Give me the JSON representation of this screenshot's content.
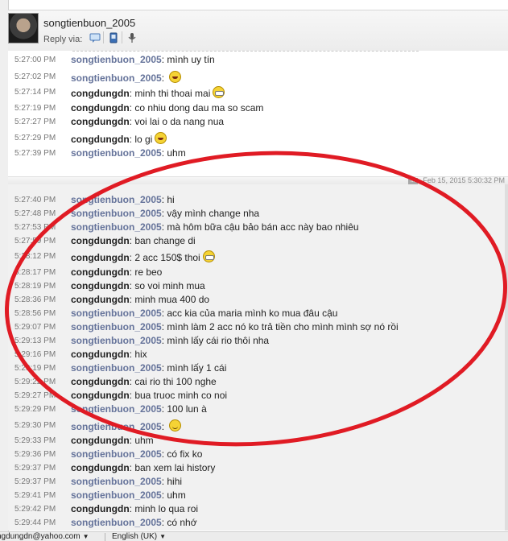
{
  "header": {
    "contact_name": "songtienbuon_2005",
    "reply_via_label": "Reply via:",
    "reply_icons": [
      "message-icon",
      "sms-icon",
      "voice-icon"
    ]
  },
  "colors": {
    "sender_other": "#65739a",
    "sender_self": "#222222",
    "annotation_ellipse": "#e01b24"
  },
  "conversation_1": {
    "messages": [
      {
        "time": "5:27:00 PM",
        "sender": "songtienbuon_2005",
        "text": "mình uy tín"
      },
      {
        "time": "5:27:02 PM",
        "sender": "songtienbuon_2005",
        "text": "",
        "emoticon": "laugh-emoticon"
      },
      {
        "time": "5:27:14 PM",
        "sender": "congdungdn",
        "text": "minh thi thoai mai",
        "emoticon": "grin-emoticon"
      },
      {
        "time": "5:27:19 PM",
        "sender": "congdungdn",
        "text": "co nhiu dong dau ma so scam"
      },
      {
        "time": "5:27:27 PM",
        "sender": "congdungdn",
        "text": "voi lai o da nang nua"
      },
      {
        "time": "5:27:29 PM",
        "sender": "congdungdn",
        "text": "lo gi",
        "emoticon": "laugh-emoticon"
      },
      {
        "time": "5:27:39 PM",
        "sender": "songtienbuon_2005",
        "text": "uhm"
      }
    ]
  },
  "divider": {
    "date": "Feb 15, 2015 5:30:32 PM"
  },
  "conversation_2": {
    "messages": [
      {
        "time": "5:27:40 PM",
        "sender": "songtienbuon_2005",
        "text": "hi"
      },
      {
        "time": "5:27:48 PM",
        "sender": "songtienbuon_2005",
        "text": "vậy mình change nha"
      },
      {
        "time": "5:27:53 PM",
        "sender": "songtienbuon_2005",
        "text": "mà hôm bữa cậu bảo bán acc này bao nhiêu"
      },
      {
        "time": "5:27:59 PM",
        "sender": "congdungdn",
        "text": "ban change di"
      },
      {
        "time": "5:28:12 PM",
        "sender": "congdungdn",
        "text": "2 acc 150$ thoi",
        "emoticon": "grin-emoticon"
      },
      {
        "time": "5:28:17 PM",
        "sender": "congdungdn",
        "text": "re beo"
      },
      {
        "time": "5:28:19 PM",
        "sender": "congdungdn",
        "text": "so voi minh mua"
      },
      {
        "time": "5:28:36 PM",
        "sender": "congdungdn",
        "text": "minh mua 400 do"
      },
      {
        "time": "5:28:56 PM",
        "sender": "songtienbuon_2005",
        "text": "acc kia của maria mình ko mua đâu cậu"
      },
      {
        "time": "5:29:07 PM",
        "sender": "songtienbuon_2005",
        "text": "mình làm 2 acc nó ko trả tiền cho mình mình sợ nó rồi"
      },
      {
        "time": "5:29:13 PM",
        "sender": "songtienbuon_2005",
        "text": "mình lấy cái rio thôi nha"
      },
      {
        "time": "5:29:16 PM",
        "sender": "congdungdn",
        "text": "hix"
      },
      {
        "time": "5:29:19 PM",
        "sender": "songtienbuon_2005",
        "text": "mình lấy 1 cái"
      },
      {
        "time": "5:29:22 PM",
        "sender": "congdungdn",
        "text": "cai rio thi 100 nghe"
      },
      {
        "time": "5:29:27 PM",
        "sender": "congdungdn",
        "text": "bua truoc minh co noi"
      },
      {
        "time": "5:29:29 PM",
        "sender": "songtienbuon_2005",
        "text": "100 lun à"
      },
      {
        "time": "5:29:30 PM",
        "sender": "songtienbuon_2005",
        "text": "",
        "emoticon": "smile-emoticon"
      },
      {
        "time": "5:29:33 PM",
        "sender": "congdungdn",
        "text": "uhm"
      },
      {
        "time": "5:29:36 PM",
        "sender": "songtienbuon_2005",
        "text": "có fix ko"
      },
      {
        "time": "5:29:37 PM",
        "sender": "congdungdn",
        "text": "ban xem lai history"
      },
      {
        "time": "5:29:37 PM",
        "sender": "songtienbuon_2005",
        "text": "hihi"
      },
      {
        "time": "5:29:41 PM",
        "sender": "songtienbuon_2005",
        "text": "uhm"
      },
      {
        "time": "5:29:42 PM",
        "sender": "congdungdn",
        "text": "minh lo qua roi"
      },
      {
        "time": "5:29:44 PM",
        "sender": "songtienbuon_2005",
        "text": "có nhớ"
      }
    ]
  },
  "statusbar": {
    "account": "ngdungdn@yahoo.com",
    "language": "English (UK)"
  }
}
